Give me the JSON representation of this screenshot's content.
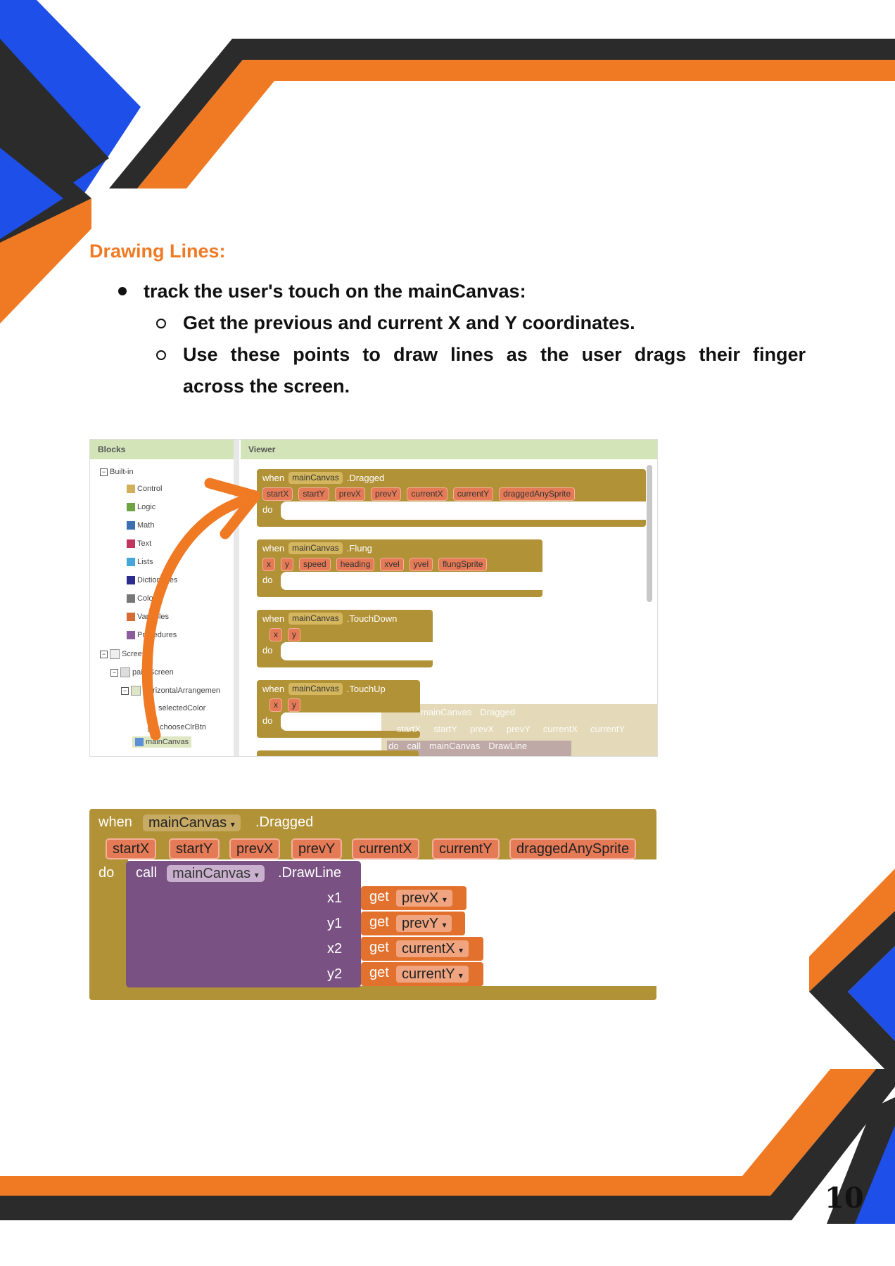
{
  "heading": "Drawing Lines:",
  "bullet": "track the user's touch on the mainCanvas:",
  "sub_bullets": [
    "Get the previous and current X and Y coordinates.",
    "Use these points to draw lines as the user drags their finger",
    "across the screen."
  ],
  "screenshot": {
    "blocks_header": "Blocks",
    "viewer_header": "Viewer",
    "tree": [
      "Built-in",
      "Control",
      "Logic",
      "Math",
      "Text",
      "Lists",
      "Dictionaries",
      "Colors",
      "Variables",
      "Procedures",
      "Screen1",
      "paintScreen",
      "HorizontalArrangemen",
      "selectedColor",
      "chooseClrBtn",
      "mainCanvas"
    ],
    "tree_colors": [
      "#d2b05a",
      "#6ea342",
      "#3c6fb0",
      "#c0365f",
      "#45a6d8",
      "#2b2c8e",
      "#777777",
      "#d76b34",
      "#8c5d9e"
    ],
    "events": [
      {
        "when": "when",
        "component": "mainCanvas",
        "event": ".Dragged",
        "params": [
          "startX",
          "startY",
          "prevX",
          "prevY",
          "currentX",
          "currentY",
          "draggedAnySprite"
        ],
        "do": "do"
      },
      {
        "when": "when",
        "component": "mainCanvas",
        "event": ".Flung",
        "params": [
          "x",
          "y",
          "speed",
          "heading",
          "xvel",
          "yvel",
          "flungSprite"
        ],
        "do": "do"
      },
      {
        "when": "when",
        "component": "mainCanvas",
        "event": ".TouchDown",
        "params": [
          "x",
          "y"
        ],
        "do": "do"
      },
      {
        "when": "when",
        "component": "mainCanvas",
        "event": ".TouchUp",
        "params": [
          "x",
          "y"
        ],
        "do": "do"
      }
    ],
    "ghost": {
      "component": "mainCanvas",
      "event": "Dragged",
      "params": [
        "startX",
        "startY",
        "prevX",
        "prevY",
        "currentX",
        "currentY"
      ],
      "do": "do",
      "call": "call",
      "call_component": "mainCanvas",
      "method": "DrawLine"
    }
  },
  "code_block": {
    "when": "when",
    "component": "mainCanvas",
    "event": ".Dragged",
    "params": [
      "startX",
      "startY",
      "prevX",
      "prevY",
      "currentX",
      "currentY",
      "draggedAnySprite"
    ],
    "do": "do",
    "call": "call",
    "call_component": "mainCanvas",
    "method": ".DrawLine",
    "args": [
      {
        "name": "x1",
        "get": "get",
        "var": "prevX"
      },
      {
        "name": "y1",
        "get": "get",
        "var": "prevY"
      },
      {
        "name": "x2",
        "get": "get",
        "var": "currentX"
      },
      {
        "name": "y2",
        "get": "get",
        "var": "currentY"
      }
    ]
  },
  "page_number": "10",
  "colors": {
    "orange": "#f07a24",
    "blue": "#1e4fe8",
    "dark": "#2b2b2b",
    "block_gold": "#b29236",
    "block_purple": "#7a5183"
  }
}
